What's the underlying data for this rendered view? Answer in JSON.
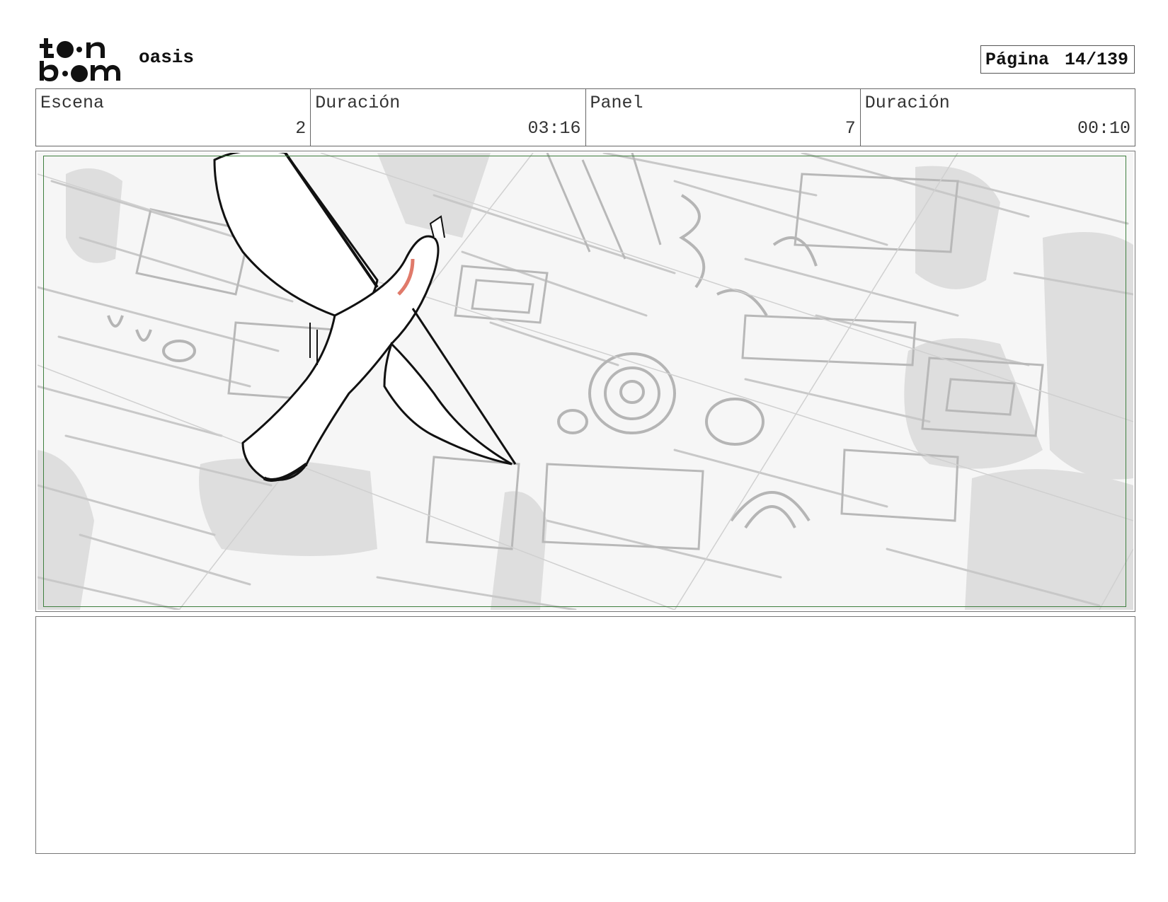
{
  "header": {
    "logo_text": "toon boom",
    "project_name": "oasis",
    "page_label": "Página",
    "page_value": "14/139"
  },
  "info": {
    "scene_label": "Escena",
    "scene_value": "2",
    "scene_duration_label": "Duración",
    "scene_duration_value": "03:16",
    "panel_label": "Panel",
    "panel_value": "7",
    "panel_duration_label": "Duración",
    "panel_duration_value": "00:10"
  },
  "panel": {
    "image_icon": "bird-flying-over-city-sketch",
    "safe_frame_color": "#3f7f3f",
    "accent_color": "#e07a6a"
  },
  "notes": {
    "text": ""
  }
}
